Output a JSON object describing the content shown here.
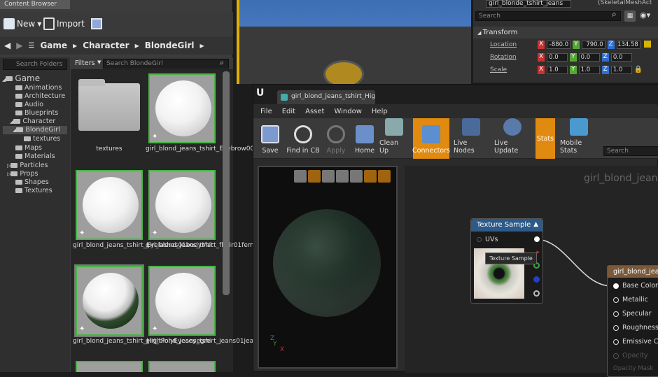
{
  "content_browser": {
    "tab_label": "Content Browser",
    "new_label": "New",
    "import_label": "Import",
    "path": [
      "Game",
      "Character",
      "BlondeGirl"
    ],
    "tree_search_placeholder": "Search Folders",
    "filters_label": "Filters",
    "asset_search_placeholder": "Search BlondeGirl",
    "tree": [
      {
        "label": "Game",
        "level": 0
      },
      {
        "label": "Animations",
        "level": 1
      },
      {
        "label": "Architecture",
        "level": 1
      },
      {
        "label": "Audio",
        "level": 1
      },
      {
        "label": "Blueprints",
        "level": 1
      },
      {
        "label": "Character",
        "level": 1
      },
      {
        "label": "BlondeGirl",
        "level": 2
      },
      {
        "label": "textures",
        "level": 3
      },
      {
        "label": "Maps",
        "level": 1
      },
      {
        "label": "Materials",
        "level": 1
      },
      {
        "label": "Particles",
        "level": 1
      },
      {
        "label": "Props",
        "level": 1
      },
      {
        "label": "Shapes",
        "level": 1
      },
      {
        "label": "Textures",
        "level": 1
      }
    ],
    "assets": [
      {
        "name": "textures"
      },
      {
        "name": "girl_blond_jeans_tshirt_Eyebrow006eyebrow"
      },
      {
        "name": "girl_blond_jeans_tshirt_Eyelashes01bodyMat"
      },
      {
        "name": "girl_blond_jeans_tshirt_fhair01female01Mate"
      },
      {
        "name": "girl_blond_jeans_tshirt_HighPolyEyeseyegre"
      },
      {
        "name": "girl_blond_jeans_tshirt_jeans01jeans01Mater"
      }
    ]
  },
  "details": {
    "actor_name": "girl_blonde_tshirt_jeans",
    "actor_type": "(SkeletalMeshAct",
    "search_placeholder": "Search",
    "section": "Transform",
    "location_label": "Location",
    "rotation_label": "Rotation",
    "scale_label": "Scale",
    "location": [
      "-880.0",
      "790.0",
      "134.58"
    ],
    "rotation": [
      "0.0",
      "0.0",
      "0.0"
    ],
    "scale": [
      "1.0",
      "1.0",
      "1.0"
    ]
  },
  "material_editor": {
    "tab_label": "girl_blond_jeans_tshirt_Hig",
    "menu": [
      "File",
      "Edit",
      "Asset",
      "Window",
      "Help"
    ],
    "toolbar": [
      "Save",
      "Find in CB",
      "Apply",
      "Home",
      "Clean Up",
      "Connectors",
      "Live Nodes",
      "Live Update",
      "Stats",
      "Mobile Stats"
    ],
    "search_placeholder": "Search",
    "graph_title": "girl_blond_jeans_",
    "texture_node": {
      "title": "Texture Sample",
      "uvs": "UVs",
      "tooltip": "Texture Sample"
    },
    "result_node": {
      "title": "girl_blond_jean",
      "pins": [
        "Base Color",
        "Metallic",
        "Specular",
        "Roughness",
        "Emissive Col",
        "Opacity",
        "Opacity Mask"
      ]
    }
  }
}
